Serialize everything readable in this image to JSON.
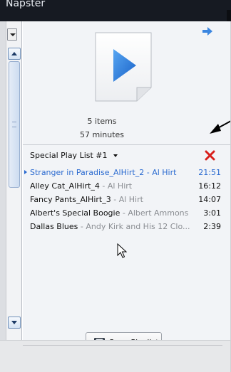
{
  "window": {
    "title": "Napster"
  },
  "playlist": {
    "summary": {
      "items": "5 items",
      "duration": "57 minutes"
    },
    "name": "Special Play List #1",
    "tracks": [
      {
        "name": "Stranger in Paradise_AlHirt_2",
        "artist": " - Al Hirt",
        "duration": "21:51",
        "playing": true
      },
      {
        "name": "Alley Cat_AlHirt_4",
        "artist": " - Al Hirt",
        "duration": "16:12",
        "playing": false
      },
      {
        "name": "Fancy Pants_AlHirt_3",
        "artist": " - Al Hirt",
        "duration": "14:07",
        "playing": false
      },
      {
        "name": "Albert's Special Boogie",
        "artist": " - Albert Ammons",
        "duration": "3:01",
        "playing": false
      },
      {
        "name": "Dallas Blues",
        "artist": " - Andy Kirk and His 12 Clo...",
        "duration": "2:39",
        "playing": false
      }
    ]
  },
  "buttons": {
    "save_playlist": "Save Playlist"
  },
  "colors": {
    "accent": "#2a6ad0",
    "remove": "#d8201c",
    "title_bar": "#161a22"
  },
  "icons": [
    "play-icon",
    "forward-arrow-icon",
    "remove-x-icon",
    "disk-icon",
    "mouse-cursor-icon",
    "chevron-down-icon"
  ]
}
